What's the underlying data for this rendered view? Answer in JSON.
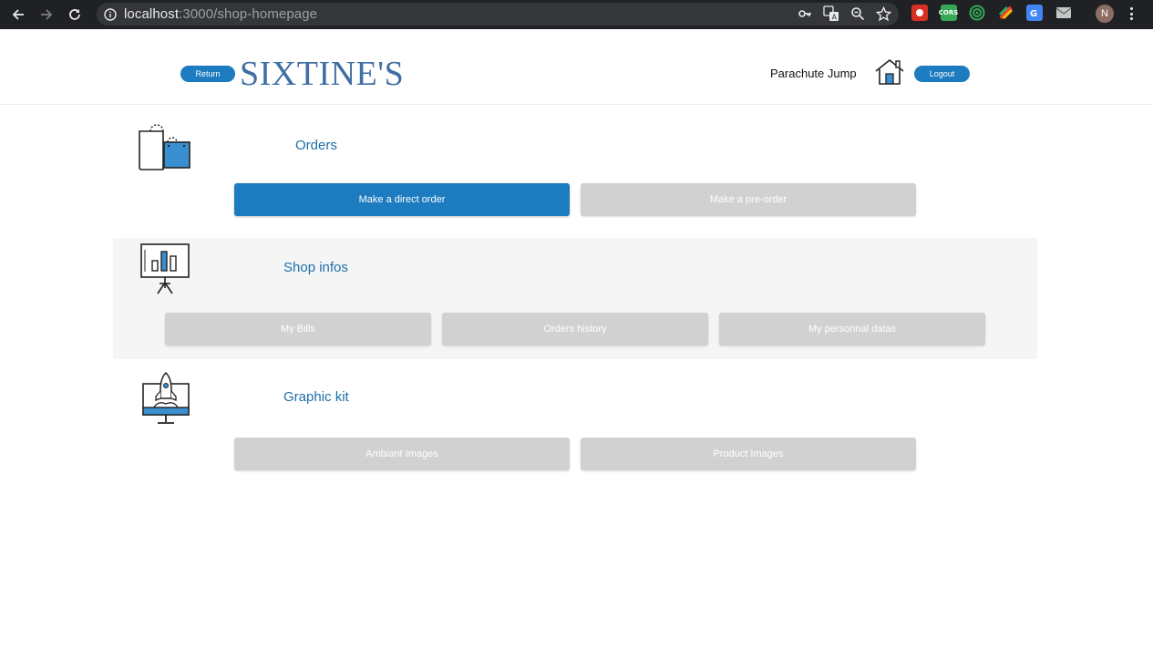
{
  "browser": {
    "url_host": "localhost",
    "url_rest": ":3000/shop-homepage",
    "avatar_letter": "N",
    "ext_cors_label": "CORS"
  },
  "header": {
    "return_label": "Return",
    "brand": "SIXTINE'S",
    "shop_name": "Parachute Jump",
    "logout_label": "Logout"
  },
  "sections": {
    "orders": {
      "title": "Orders",
      "buttons": [
        "Make a direct order",
        "Make a pre-order"
      ]
    },
    "shop_infos": {
      "title": "Shop infos",
      "buttons": [
        "My Bills",
        "Orders history",
        "My personnal datas"
      ]
    },
    "graphic_kit": {
      "title": "Graphic kit",
      "buttons": [
        "Ambiant Images",
        "Product Images"
      ]
    }
  },
  "colors": {
    "accent": "#1d7bbf",
    "brand": "#3f6fa3",
    "title": "#1d6fa8",
    "disabled": "#d1d1d1",
    "band": "#f5f5f5"
  }
}
